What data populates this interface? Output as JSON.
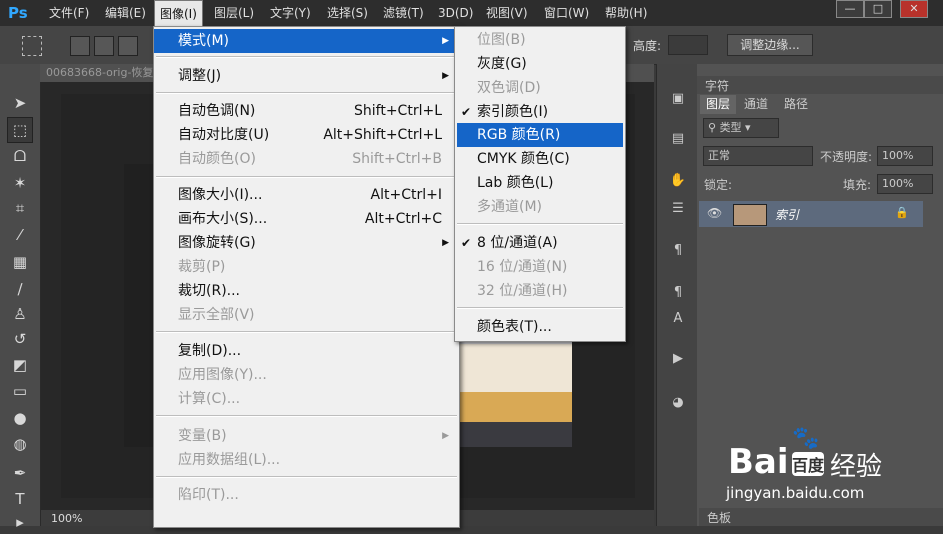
{
  "app": {
    "logo": "Ps"
  },
  "menubar": {
    "items": [
      "文件(F)",
      "编辑(E)",
      "图像(I)",
      "图层(L)",
      "文字(Y)",
      "选择(S)",
      "滤镜(T)",
      "3D(D)",
      "视图(V)",
      "窗口(W)",
      "帮助(H)"
    ],
    "window_buttons": {
      "minimize": "—",
      "restore": "□",
      "close": "✕"
    }
  },
  "options_bar": {
    "height_label": "高度:",
    "refine_edge": "调整边缘..."
  },
  "document": {
    "tab": "00683668-orig-恢复",
    "zoom": "100%"
  },
  "image_menu": {
    "items": [
      {
        "label": "模式(M)",
        "shortcut": "",
        "submenu": true,
        "disabled": false,
        "highlighted": true
      },
      {
        "label": "调整(J)",
        "shortcut": "",
        "submenu": true,
        "disabled": false
      },
      {
        "label": "自动色调(N)",
        "shortcut": "Shift+Ctrl+L",
        "disabled": false
      },
      {
        "label": "自动对比度(U)",
        "shortcut": "Alt+Shift+Ctrl+L",
        "disabled": false
      },
      {
        "label": "自动颜色(O)",
        "shortcut": "Shift+Ctrl+B",
        "disabled": true
      },
      {
        "label": "图像大小(I)...",
        "shortcut": "Alt+Ctrl+I",
        "disabled": false
      },
      {
        "label": "画布大小(S)...",
        "shortcut": "Alt+Ctrl+C",
        "disabled": false
      },
      {
        "label": "图像旋转(G)",
        "shortcut": "",
        "submenu": true,
        "disabled": false
      },
      {
        "label": "裁剪(P)",
        "shortcut": "",
        "disabled": true
      },
      {
        "label": "裁切(R)...",
        "shortcut": "",
        "disabled": false
      },
      {
        "label": "显示全部(V)",
        "shortcut": "",
        "disabled": true
      },
      {
        "label": "复制(D)...",
        "shortcut": "",
        "disabled": false
      },
      {
        "label": "应用图像(Y)...",
        "shortcut": "",
        "disabled": true
      },
      {
        "label": "计算(C)...",
        "shortcut": "",
        "disabled": true
      },
      {
        "label": "变量(B)",
        "shortcut": "",
        "submenu": true,
        "disabled": true
      },
      {
        "label": "应用数据组(L)...",
        "shortcut": "",
        "disabled": true
      },
      {
        "label": "陷印(T)...",
        "shortcut": "",
        "disabled": true
      }
    ]
  },
  "mode_menu": {
    "items": [
      {
        "label": "位图(B)",
        "disabled": true,
        "checked": false
      },
      {
        "label": "灰度(G)",
        "disabled": false,
        "checked": false
      },
      {
        "label": "双色调(D)",
        "disabled": true,
        "checked": false
      },
      {
        "label": "索引颜色(I)",
        "disabled": false,
        "checked": true
      },
      {
        "label": "RGB 颜色(R)",
        "disabled": false,
        "checked": false,
        "highlighted": true
      },
      {
        "label": "CMYK 颜色(C)",
        "disabled": false,
        "checked": false
      },
      {
        "label": "Lab 颜色(L)",
        "disabled": false,
        "checked": false
      },
      {
        "label": "多通道(M)",
        "disabled": true,
        "checked": false
      },
      {
        "label": "8 位/通道(A)",
        "disabled": false,
        "checked": true
      },
      {
        "label": "16 位/通道(N)",
        "disabled": true,
        "checked": false
      },
      {
        "label": "32 位/通道(H)",
        "disabled": true,
        "checked": false
      },
      {
        "label": "颜色表(T)...",
        "disabled": false,
        "checked": false
      }
    ]
  },
  "panels": {
    "character_tab": "字符",
    "tabs": [
      "图层",
      "通道",
      "路径"
    ],
    "filter_kind": "类型",
    "blend_mode": "正常",
    "opacity_label": "不透明度:",
    "opacity_value": "100%",
    "lock_label": "锁定:",
    "fill_label": "填充:",
    "fill_value": "100%",
    "layer_name": "索引",
    "bottom_tab": "色板"
  },
  "watermark": {
    "brand": "Bai",
    "brand2": "百度",
    "product": "经验",
    "url": "jingyan.baidu.com"
  },
  "colors": {
    "highlight": "#1565c8",
    "menu_bg": "#f0f0f0",
    "ps_blue": "#31a8ff"
  }
}
